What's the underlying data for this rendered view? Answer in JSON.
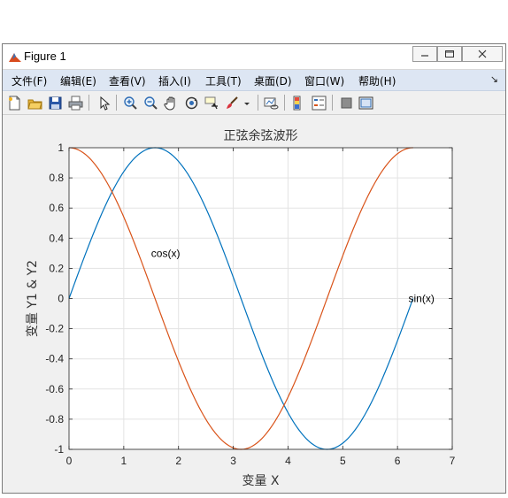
{
  "window": {
    "title": "Figure 1"
  },
  "menu": {
    "items": [
      "文件(F)",
      "编辑(E)",
      "查看(V)",
      "插入(I)",
      "工具(T)",
      "桌面(D)",
      "窗口(W)",
      "帮助(H)"
    ]
  },
  "toolbar": {
    "icons": [
      "new-figure-icon",
      "open-file-icon",
      "save-icon",
      "print-icon",
      "pointer-icon",
      "zoom-in-icon",
      "zoom-out-icon",
      "pan-hand-icon",
      "rotate-3d-icon",
      "data-cursor-icon",
      "brush-icon",
      "brush-dropdown-icon",
      "link-plot-icon",
      "insert-colorbar-icon",
      "insert-legend-icon",
      "hide-plot-tools-icon",
      "show-plot-tools-icon"
    ]
  },
  "chart_data": {
    "type": "line",
    "title": "正弦余弦波形",
    "xlabel": "变量 X",
    "ylabel": "变量 Y1 & Y2",
    "xlim": [
      0,
      7
    ],
    "ylim": [
      -1,
      1
    ],
    "xticks": [
      "0",
      "1",
      "2",
      "3",
      "4",
      "5",
      "6",
      "7"
    ],
    "yticks": [
      "1",
      "0.8",
      "0.6",
      "0.4",
      "0.2",
      "0",
      "-0.2",
      "-0.4",
      "-0.6",
      "-0.8",
      "-1"
    ],
    "grid": true,
    "x_range": [
      0,
      6.2832
    ],
    "series": [
      {
        "function": "sin",
        "color": "#0072BD"
      },
      {
        "function": "cos",
        "color": "#D95319"
      }
    ],
    "annotations": [
      {
        "text": "cos(x)",
        "x": 1.5,
        "y": 0.3
      },
      {
        "text": "sin(x)",
        "x": 6.2,
        "y": 0.0
      }
    ]
  }
}
